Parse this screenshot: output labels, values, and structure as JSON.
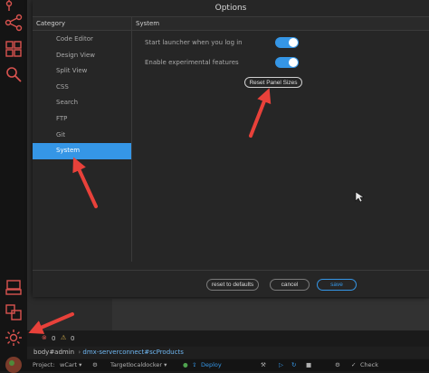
{
  "dialog": {
    "title": "Options",
    "category_header": "Category",
    "settings_header": "System",
    "categories": [
      {
        "label": "Code Editor",
        "active": false
      },
      {
        "label": "Design View",
        "active": false
      },
      {
        "label": "Split View",
        "active": false
      },
      {
        "label": "CSS",
        "active": false
      },
      {
        "label": "Search",
        "active": false
      },
      {
        "label": "FTP",
        "active": false
      },
      {
        "label": "Git",
        "active": false
      },
      {
        "label": "System",
        "active": true
      }
    ],
    "settings": {
      "launch_on_login": {
        "label": "Start launcher when you log in",
        "on": true
      },
      "experimental": {
        "label": "Enable experimental features",
        "on": true
      },
      "reset_panels_label": "Reset Panel Sizes"
    },
    "footer": {
      "reset_defaults": "reset to defaults",
      "cancel": "cancel",
      "save": "save"
    }
  },
  "status": {
    "errors": "0",
    "warnings": "0"
  },
  "breadcrumb": {
    "parts": [
      "body",
      "#admin",
      "dmx-serverconnect",
      "#scProducts"
    ]
  },
  "bottombar": {
    "project_label": "Project:",
    "project_value": "wCart ▾",
    "target_label": "Target:",
    "target_value": "localdocker ▾",
    "deploy": "Deploy",
    "check": "Check"
  },
  "colors": {
    "accent": "#3596e6",
    "annotation_arrow": "#e8413a"
  }
}
